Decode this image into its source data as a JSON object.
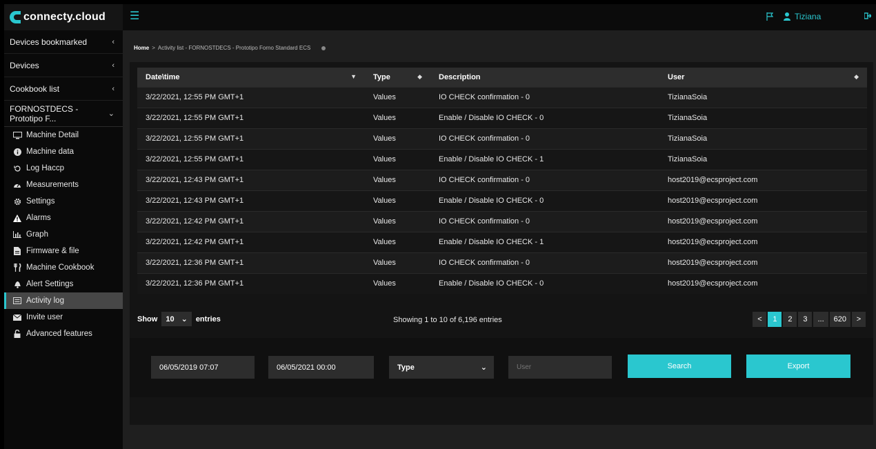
{
  "brand": {
    "name": "connecty.cloud",
    "accent": "#2ac7cf"
  },
  "header": {
    "user_name": "Tiziana"
  },
  "sidebar": {
    "sections": [
      {
        "label": "Devices bookmarked"
      },
      {
        "label": "Devices"
      },
      {
        "label": "Cookbook list"
      }
    ],
    "machine": {
      "label": "FORNOSTDECS - Prototipo F..."
    },
    "items": [
      {
        "label": "Machine Detail",
        "icon": "monitor-icon"
      },
      {
        "label": "Machine data",
        "icon": "info-icon"
      },
      {
        "label": "Log Haccp",
        "icon": "history-icon"
      },
      {
        "label": "Measurements",
        "icon": "gauge-icon"
      },
      {
        "label": "Settings",
        "icon": "gear-icon"
      },
      {
        "label": "Alarms",
        "icon": "warning-icon"
      },
      {
        "label": "Graph",
        "icon": "chart-icon"
      },
      {
        "label": "Firmware & file",
        "icon": "file-icon"
      },
      {
        "label": "Machine Cookbook",
        "icon": "cutlery-icon"
      },
      {
        "label": "Alert Settings",
        "icon": "bell-icon"
      },
      {
        "label": "Activity log",
        "icon": "list-icon"
      },
      {
        "label": "Invite user",
        "icon": "envelope-icon"
      },
      {
        "label": "Advanced features",
        "icon": "unlock-icon"
      }
    ]
  },
  "breadcrumb": {
    "home": "Home",
    "sep": ">",
    "path": "Activity list - FORNOSTDECS - Prototipo Forno Standard ECS"
  },
  "table": {
    "columns": [
      "Date\\time",
      "Type",
      "Description",
      "User"
    ],
    "rows": [
      [
        "3/22/2021, 12:55 PM GMT+1",
        "Values",
        "IO CHECK confirmation - 0",
        "TizianaSoia"
      ],
      [
        "3/22/2021, 12:55 PM GMT+1",
        "Values",
        "Enable / Disable IO CHECK - 0",
        "TizianaSoia"
      ],
      [
        "3/22/2021, 12:55 PM GMT+1",
        "Values",
        "IO CHECK confirmation - 0",
        "TizianaSoia"
      ],
      [
        "3/22/2021, 12:55 PM GMT+1",
        "Values",
        "Enable / Disable IO CHECK - 1",
        "TizianaSoia"
      ],
      [
        "3/22/2021, 12:43 PM GMT+1",
        "Values",
        "IO CHECK confirmation - 0",
        "host2019@ecsproject.com"
      ],
      [
        "3/22/2021, 12:43 PM GMT+1",
        "Values",
        "Enable / Disable IO CHECK - 0",
        "host2019@ecsproject.com"
      ],
      [
        "3/22/2021, 12:42 PM GMT+1",
        "Values",
        "IO CHECK confirmation - 0",
        "host2019@ecsproject.com"
      ],
      [
        "3/22/2021, 12:42 PM GMT+1",
        "Values",
        "Enable / Disable IO CHECK - 1",
        "host2019@ecsproject.com"
      ],
      [
        "3/22/2021, 12:36 PM GMT+1",
        "Values",
        "IO CHECK confirmation - 0",
        "host2019@ecsproject.com"
      ],
      [
        "3/22/2021, 12:36 PM GMT+1",
        "Values",
        "Enable / Disable IO CHECK - 0",
        "host2019@ecsproject.com"
      ]
    ]
  },
  "length": {
    "show": "Show",
    "value": "10",
    "entries": "entries"
  },
  "info": "Showing 1 to 10 of 6,196 entries",
  "pagination": {
    "prev": "<",
    "pages": [
      "1",
      "2",
      "3",
      "...",
      "620"
    ],
    "next": ">",
    "active": "1"
  },
  "filters": {
    "date_from": "06/05/2019 07:07",
    "date_to": "06/05/2021 00:00",
    "type_value": "Type",
    "user_placeholder": "User",
    "search_label": "Search",
    "export_label": "Export"
  }
}
